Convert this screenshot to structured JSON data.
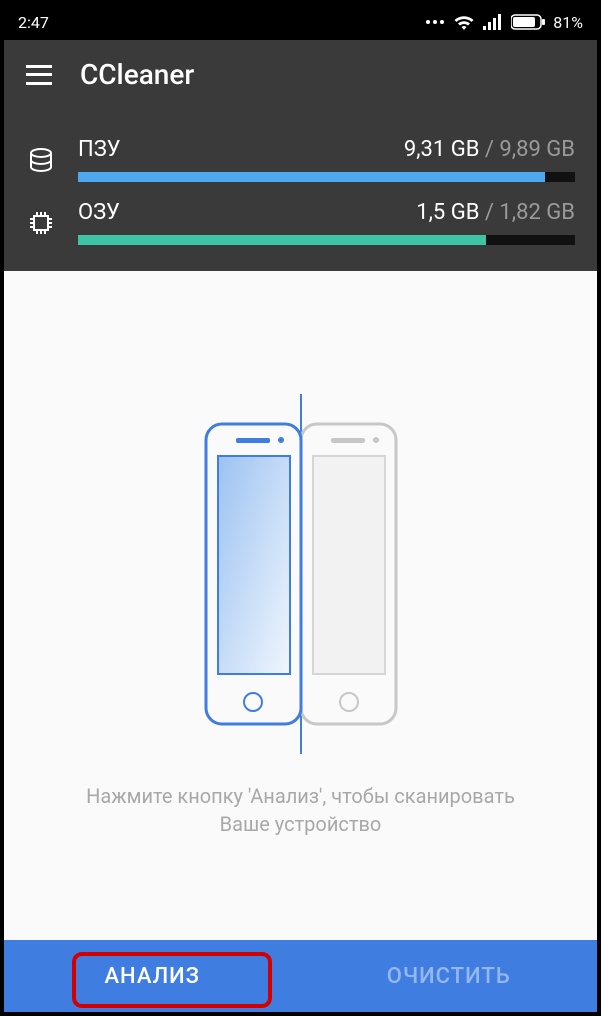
{
  "statusbar": {
    "time": "2:47",
    "battery_pct": "81%"
  },
  "app": {
    "title": "CCleaner"
  },
  "storage": {
    "label": "ПЗУ",
    "used": "9,31 GB",
    "sep": " / ",
    "total": "9,89 GB",
    "fill_pct": 94
  },
  "ram": {
    "label": "ОЗУ",
    "used": "1,5 GB",
    "sep": " / ",
    "total": "1,82 GB",
    "fill_pct": 82
  },
  "main": {
    "message_line1": "Нажмите кнопку 'Анализ', чтобы сканировать",
    "message_line2": "Ваше устройство"
  },
  "buttons": {
    "analyze": "АНАЛИЗ",
    "clean": "ОЧИСТИТЬ"
  }
}
